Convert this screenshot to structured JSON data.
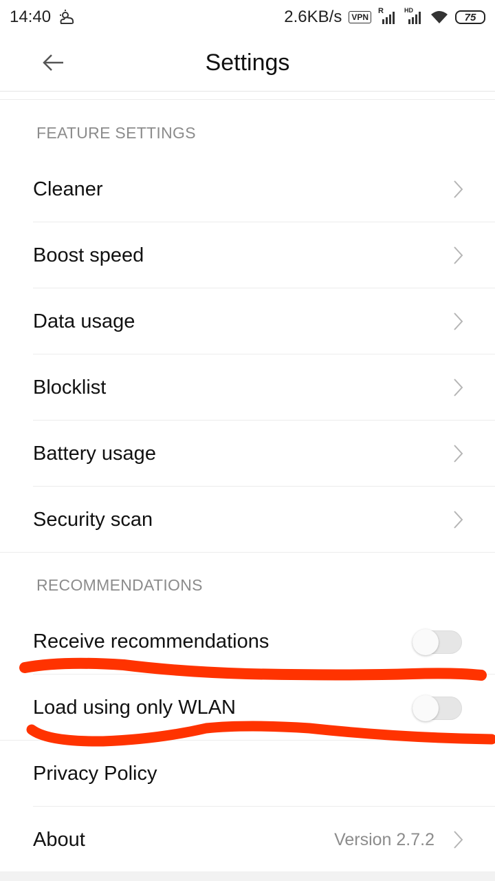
{
  "status_bar": {
    "time": "14:40",
    "net_speed": "2.6KB/s",
    "vpn": "VPN",
    "signal1_tag": "R",
    "signal2_tag": "HD",
    "battery": "75"
  },
  "header": {
    "title": "Settings"
  },
  "sections": {
    "feature": {
      "label": "FEATURE SETTINGS",
      "items": [
        "Cleaner",
        "Boost speed",
        "Data usage",
        "Blocklist",
        "Battery usage",
        "Security scan"
      ]
    },
    "recommendations": {
      "label": "RECOMMENDATIONS",
      "items": [
        {
          "label": "Receive recommendations",
          "enabled": false
        },
        {
          "label": "Load using only WLAN",
          "enabled": false
        }
      ]
    }
  },
  "privacy": {
    "label": "Privacy Policy"
  },
  "about": {
    "label": "About",
    "version": "Version 2.7.2"
  },
  "colors": {
    "annotation": "#ff3300",
    "toggle_off": "#e6e6e6",
    "chevron": "#b5b5b5"
  },
  "icons": [
    "weather-cloud-icon",
    "wifi-icon",
    "signal-icon",
    "back-arrow-icon",
    "chevron-right-icon"
  ]
}
